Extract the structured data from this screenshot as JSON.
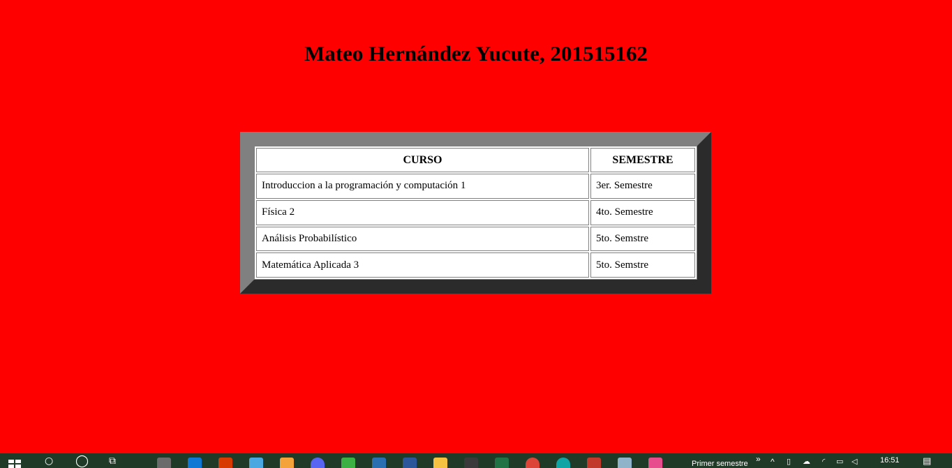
{
  "page": {
    "title": "Mateo Hernández Yucute, 201515162",
    "background_color": "#ff0000"
  },
  "table": {
    "headers": [
      "CURSO",
      "SEMESTRE"
    ],
    "rows": [
      [
        "Introduccion a la programación y computación 1",
        "3er. Semestre"
      ],
      [
        "Física 2",
        "4to. Semestre"
      ],
      [
        "Análisis Probabilístico",
        "5to. Semstre"
      ],
      [
        "Matemática Aplicada 3",
        "5to. Semstre"
      ]
    ]
  },
  "taskbar": {
    "color": "#1f3a26",
    "apps": [
      {
        "icon": "start-windows-icon"
      },
      {
        "icon": "search-icon"
      },
      {
        "icon": "cortana-icon"
      },
      {
        "icon": "task-view-icon"
      },
      {
        "icon": "app-icon",
        "color": "#6b6b6b"
      },
      {
        "icon": "mail-icon",
        "color": "#0f78d4"
      },
      {
        "icon": "office-icon",
        "color": "#d83b01"
      },
      {
        "icon": "store-icon",
        "color": "#4aa8e0"
      },
      {
        "icon": "app-icon",
        "color": "#f4a23a"
      },
      {
        "icon": "discord-icon",
        "color": "#5865f2"
      },
      {
        "icon": "app-icon",
        "color": "#3cb043"
      },
      {
        "icon": "app-icon",
        "color": "#2a6fb0"
      },
      {
        "icon": "word-icon",
        "color": "#2b579a"
      },
      {
        "icon": "file-explorer-icon",
        "color": "#f5c242"
      },
      {
        "icon": "app-icon",
        "color": "#3a3a3a"
      },
      {
        "icon": "excel-icon",
        "color": "#217346"
      },
      {
        "icon": "chrome-icon",
        "color": "#db4437"
      },
      {
        "icon": "edge-icon",
        "color": "#0fa5a5"
      },
      {
        "icon": "app-icon",
        "color": "#c0392b"
      },
      {
        "icon": "app-icon",
        "color": "#8fb3c9"
      },
      {
        "icon": "app-icon",
        "color": "#e74c8c"
      }
    ],
    "toolbar_label": "Primer semestre",
    "chevron_glyph": "»",
    "tray_glyph": "^",
    "clock": "16:51"
  }
}
